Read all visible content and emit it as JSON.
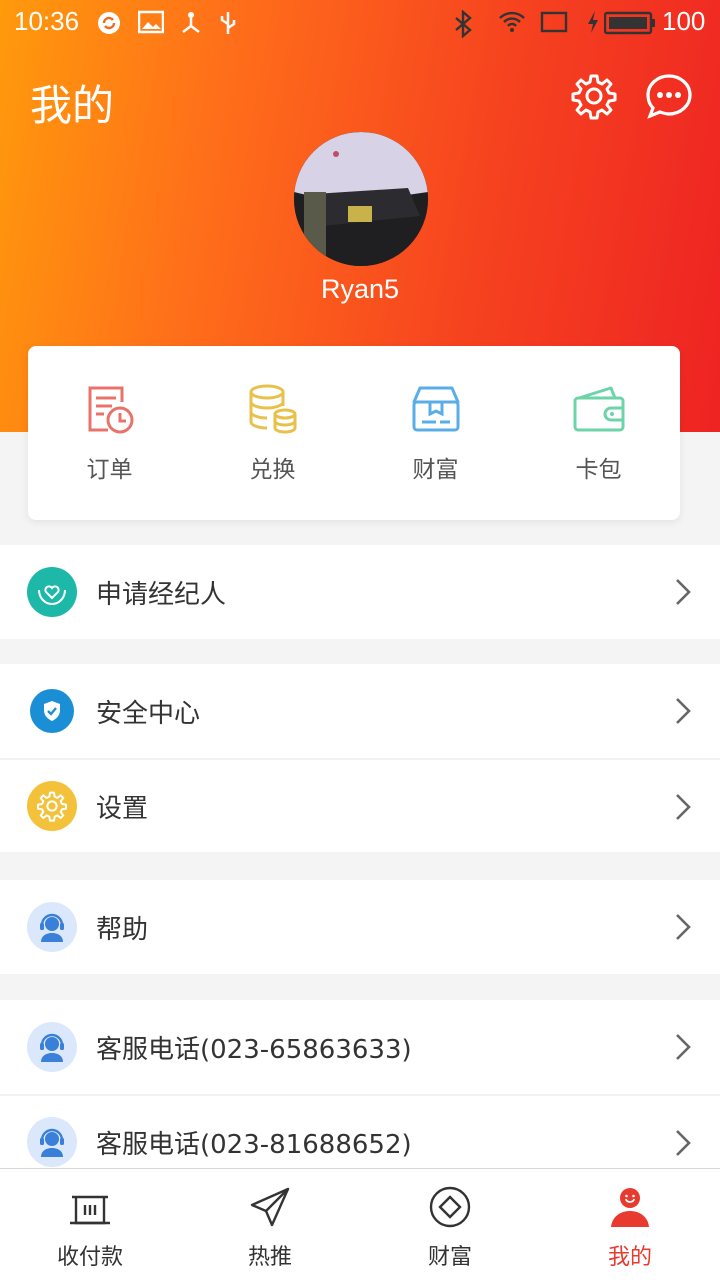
{
  "status_bar": {
    "time": "10:36",
    "battery": "100"
  },
  "header": {
    "title": "我的",
    "username": "Ryan5"
  },
  "quick_actions": [
    {
      "label": "订单",
      "icon": "order-icon",
      "color": "#e8736a"
    },
    {
      "label": "兑换",
      "icon": "coins-icon",
      "color": "#e8c14a"
    },
    {
      "label": "财富",
      "icon": "treasure-box-icon",
      "color": "#5aaee8"
    },
    {
      "label": "卡包",
      "icon": "wallet-icon",
      "color": "#6dd3a8"
    }
  ],
  "menu": {
    "agent": {
      "label": "申请经纪人",
      "icon": "heart-hands-icon",
      "color": "#1db8a8"
    },
    "security": {
      "label": "安全中心",
      "icon": "shield-icon",
      "color": "#1a8fd6"
    },
    "settings": {
      "label": "设置",
      "icon": "gear-icon",
      "color": "#f3c13a"
    },
    "help": {
      "label": "帮助",
      "icon": "support-agent-icon",
      "color": "#3a7fd8"
    },
    "phone1": {
      "label": "客服电话(023-65863633)",
      "icon": "support-agent-icon"
    },
    "phone2": {
      "label": "客服电话(023-81688652)",
      "icon": "support-agent-icon"
    }
  },
  "tabs": [
    {
      "label": "收付款",
      "icon": "payment-icon",
      "active": false
    },
    {
      "label": "热推",
      "icon": "send-icon",
      "active": false
    },
    {
      "label": "财富",
      "icon": "diamond-icon",
      "active": false
    },
    {
      "label": "我的",
      "icon": "user-icon",
      "active": true
    }
  ],
  "colors": {
    "accent": "#e83a2e",
    "header_start": "#ff9a0c",
    "header_end": "#ee2323"
  }
}
